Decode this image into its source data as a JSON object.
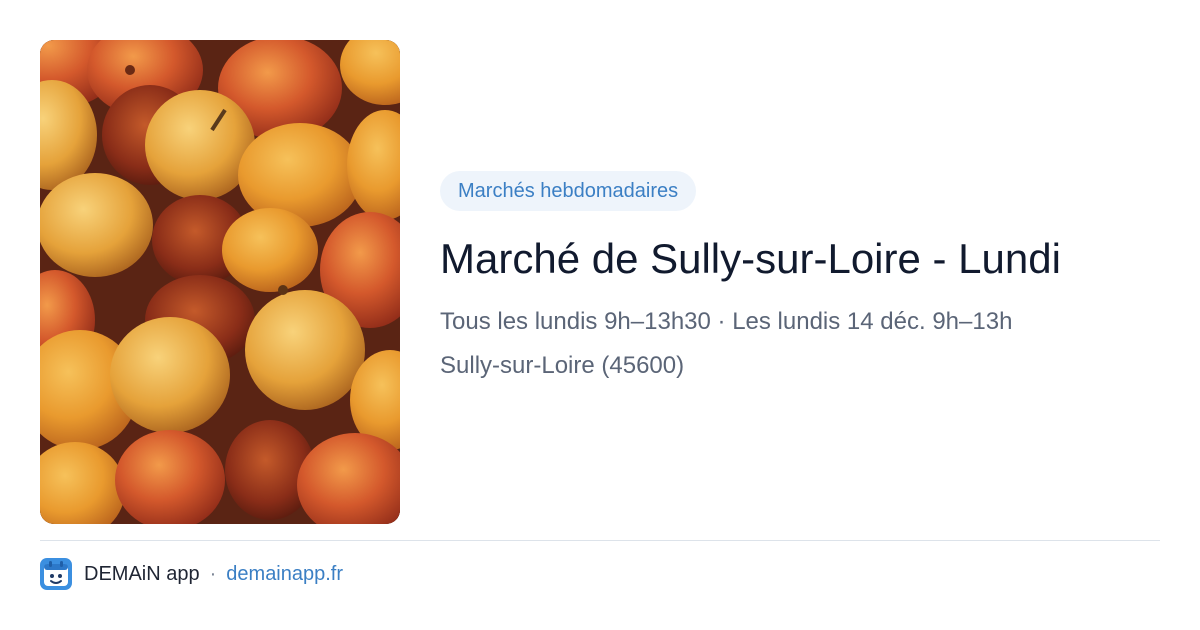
{
  "card": {
    "image": {
      "subject": "apricots photo"
    },
    "category_tag": "Marchés hebdomadaires",
    "title": "Marché de Sully-sur-Loire - Lundi",
    "schedule": "Tous les lundis 9h–13h30 · Les lundis 14 déc. 9h–13h",
    "location": "Sully-sur-Loire (45600)"
  },
  "footer": {
    "app_icon": "demain-app-icon",
    "app_name": "DEMAiN app",
    "separator": "·",
    "site": "demainapp.fr"
  },
  "colors": {
    "tag_background": "#eef4fb",
    "accent_blue": "#3b7fc4",
    "title_text": "#111a2e",
    "body_text": "#5b6577",
    "divider": "#dde3ea"
  }
}
